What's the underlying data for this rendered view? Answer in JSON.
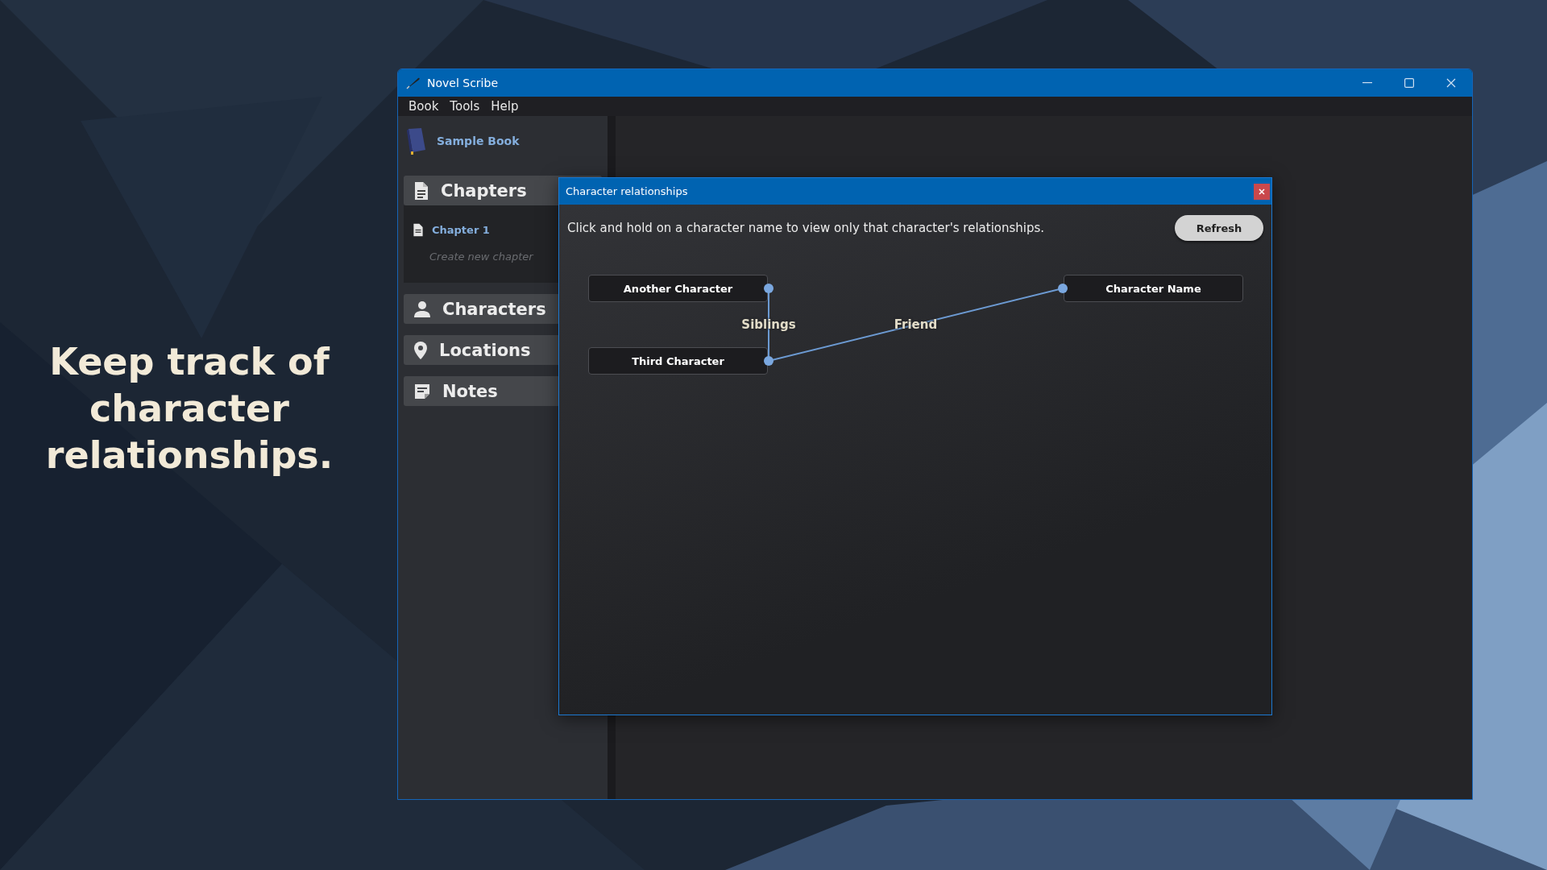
{
  "promo_text": "Keep track of character relationships.",
  "window": {
    "title": "Novel Scribe"
  },
  "menu": [
    "Book",
    "Tools",
    "Help"
  ],
  "sidebar": {
    "book": "Sample Book",
    "sections": [
      {
        "label": "Chapters",
        "expanded": true,
        "children": [
          {
            "label": "Chapter 1"
          }
        ],
        "create_item": "Create new chapter"
      },
      {
        "label": "Characters",
        "expanded": false
      },
      {
        "label": "Locations",
        "expanded": false
      },
      {
        "label": "Notes",
        "expanded": false
      }
    ]
  },
  "dialog": {
    "title": "Character relationships",
    "instructions": "Click and hold on a character name to view only that character's relationships.",
    "refresh_button": "Refresh",
    "graph": {
      "nodes": [
        {
          "name": "Another Character"
        },
        {
          "name": "Third Character"
        },
        {
          "name": "Character Name"
        }
      ],
      "edges": [
        {
          "label": "Siblings"
        },
        {
          "label": "Friend"
        }
      ]
    }
  }
}
